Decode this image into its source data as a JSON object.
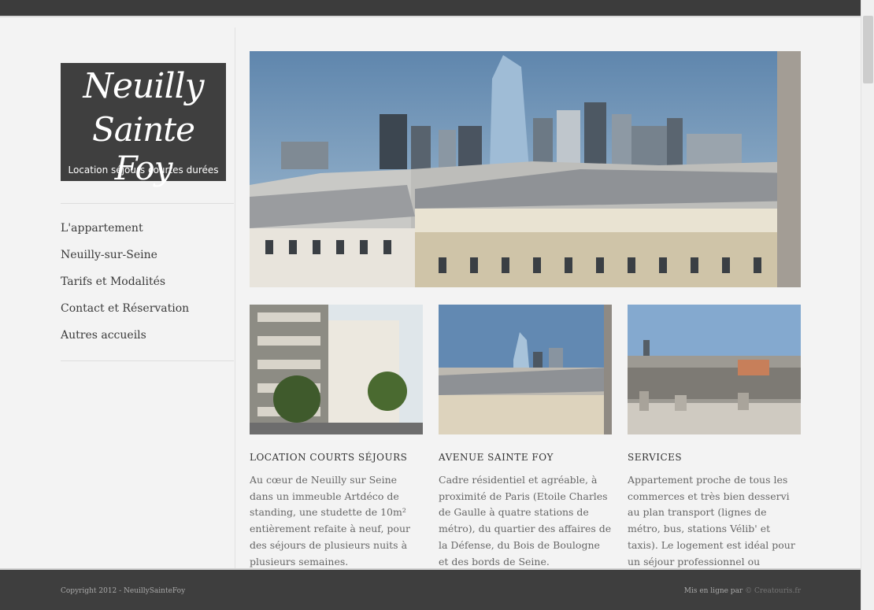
{
  "logo": {
    "line1": "Neuilly",
    "line2": "Sainte Foy",
    "tagline": "Location séjours courtes durées"
  },
  "nav": {
    "items": [
      {
        "label": "L'appartement"
      },
      {
        "label": "Neuilly-sur-Seine"
      },
      {
        "label": "Tarifs et Modalités"
      },
      {
        "label": "Contact et Réservation"
      },
      {
        "label": "Autres accueils"
      }
    ]
  },
  "columns": [
    {
      "title": "LOCATION COURTS SÉJOURS",
      "text": "Au cœur de Neuilly sur Seine dans un immeuble Artdéco de standing, une studette de 10m² entièrement refaite à neuf, pour des séjours de plusieurs nuits à plusieurs semaines. L'aménagement raffiné et optimisé"
    },
    {
      "title": "AVENUE SAINTE FOY",
      "text": "Cadre résidentiel et agréable, à proximité de Paris (Etoile Charles de Gaulle à quatre stations de métro), du quartier des affaires de la Défense, du Bois de Boulogne et des bords de Seine."
    },
    {
      "title": "SERVICES",
      "text": "Appartement proche de tous les commerces et très bien desservi au plan transport (lignes de métro, bus, stations Vélib' et taxis). Le logement est idéal pour un séjour professionnel ou touristique."
    }
  ],
  "footer": {
    "copyright": "Copyright 2012 - NeuillySainteFoy",
    "credit_prefix": "Mis en ligne par",
    "credit_link": "© Creatouris.fr"
  },
  "colors": {
    "topbar": "#3c3c3c",
    "footer": "#3e3e3e",
    "logo_bg": "#3f3f3f"
  }
}
